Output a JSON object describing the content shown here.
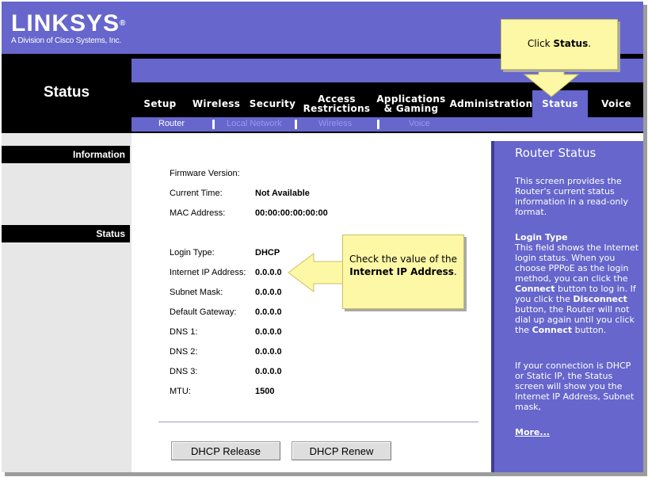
{
  "brand": {
    "name": "LINKSYS",
    "registered": "®",
    "tagline": "A Division of Cisco Systems, Inc."
  },
  "page": {
    "section_title": "Status"
  },
  "tabs": [
    {
      "label": "Setup"
    },
    {
      "label": "Wireless"
    },
    {
      "label": "Security"
    },
    {
      "label": "Access Restrictions"
    },
    {
      "label": "Applications & Gaming"
    },
    {
      "label": "Administration"
    },
    {
      "label": "Status"
    },
    {
      "label": "Voice"
    }
  ],
  "subtabs": [
    {
      "label": "Router"
    },
    {
      "label": "Local Network"
    },
    {
      "label": "Wireless"
    },
    {
      "label": "Voice"
    }
  ],
  "left_nav": {
    "information": "Information",
    "status": "Status"
  },
  "info": {
    "firmware_label": "Firmware Version:",
    "firmware_value": "",
    "time_label": "Current Time:",
    "time_value": "Not Available",
    "mac_label": "MAC Address:",
    "mac_value": "00:00:00:00:00:00"
  },
  "status": {
    "login_type_label": "Login Type:",
    "login_type_value": "DHCP",
    "ip_label": "Internet IP Address:",
    "ip_value": "0.0.0.0",
    "subnet_label": "Subnet Mask:",
    "subnet_value": "0.0.0.0",
    "gateway_label": "Default Gateway:",
    "gateway_value": "0.0.0.0",
    "dns1_label": "DNS 1:",
    "dns1_value": "0.0.0.0",
    "dns2_label": "DNS 2:",
    "dns2_value": "0.0.0.0",
    "dns3_label": "DNS 3:",
    "dns3_value": "0.0.0.0",
    "mtu_label": "MTU:",
    "mtu_value": "1500"
  },
  "buttons": {
    "release": "DHCP Release",
    "renew": "DHCP Renew"
  },
  "help": {
    "title": "Router Status",
    "intro": "This screen provides the Router's current status information in a read-only format.",
    "login_heading": "Login Type",
    "login_text_1": "This field shows the Internet login status. When you choose PPPoE as the login method, you can click the ",
    "login_bold_connect": "Connect",
    "login_text_2": " button to log in. If you click the ",
    "login_bold_disconnect": "Disconnect",
    "login_text_3": " button, the Router will not dial up again until you click the ",
    "login_bold_connect2": "Connect",
    "login_text_4": " button.",
    "dhcp_text": "If your connection is DHCP or Static IP, the Status screen will show you the Internet IP Address, Subnet mask,",
    "more": "More..."
  },
  "callouts": {
    "status_prefix": "Click ",
    "status_bold": "Status",
    "status_suffix": ".",
    "ip_prefix": "Check the value of the ",
    "ip_bold": "Internet IP Address",
    "ip_suffix": "."
  },
  "colors": {
    "brand_purple": "#6666cc",
    "callout_yellow": "#fdf8a6"
  }
}
